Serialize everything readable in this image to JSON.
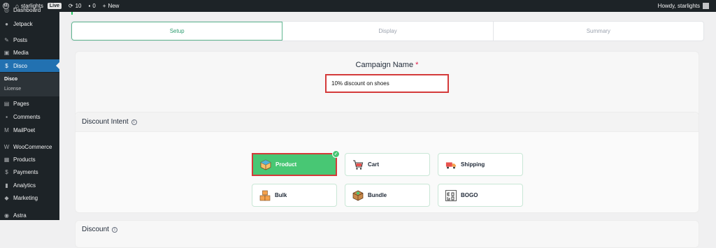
{
  "adminbar": {
    "site_name": "starlights",
    "live_badge": "Live",
    "updates_count": "10",
    "comments_count": "0",
    "new_label": "New",
    "greeting": "Howdy, starlights"
  },
  "sidebar": {
    "items": [
      {
        "label": "Dashboard",
        "icon": "dashboard-icon"
      },
      {
        "label": "Jetpack",
        "icon": "jetpack-icon"
      },
      {
        "label": "Posts",
        "icon": "pin-icon"
      },
      {
        "label": "Media",
        "icon": "media-icon"
      },
      {
        "label": "Disco",
        "icon": "disco-icon"
      },
      {
        "label": "Pages",
        "icon": "pages-icon"
      },
      {
        "label": "Comments",
        "icon": "comment-icon"
      },
      {
        "label": "MailPoet",
        "icon": "mailpoet-icon"
      },
      {
        "label": "WooCommerce",
        "icon": "woocommerce-icon"
      },
      {
        "label": "Products",
        "icon": "products-icon"
      },
      {
        "label": "Payments",
        "icon": "payments-icon"
      },
      {
        "label": "Analytics",
        "icon": "analytics-icon"
      },
      {
        "label": "Marketing",
        "icon": "marketing-icon"
      },
      {
        "label": "Astra",
        "icon": "astra-icon"
      }
    ],
    "submenu": [
      {
        "label": "Disco"
      },
      {
        "label": "License"
      }
    ]
  },
  "steps": [
    {
      "label": "Setup"
    },
    {
      "label": "Display"
    },
    {
      "label": "Summary"
    }
  ],
  "campaign": {
    "label": "Campaign Name",
    "required_mark": "*",
    "value": "10% discount on shoes"
  },
  "intent": {
    "title": "Discount Intent",
    "options": [
      {
        "label": "Product",
        "icon": "product-box-icon"
      },
      {
        "label": "Cart",
        "icon": "cart-icon"
      },
      {
        "label": "Shipping",
        "icon": "shipping-truck-icon"
      },
      {
        "label": "Bulk",
        "icon": "bulk-boxes-icon"
      },
      {
        "label": "Bundle",
        "icon": "bundle-icon"
      },
      {
        "label": "BOGO",
        "icon": "bogo-icon"
      }
    ]
  },
  "discount": {
    "title": "Discount"
  },
  "colors": {
    "primary_green": "#48c774",
    "highlight_red": "#d43a3a",
    "wp_blue": "#2271b1",
    "admin_dark": "#1d2327"
  }
}
